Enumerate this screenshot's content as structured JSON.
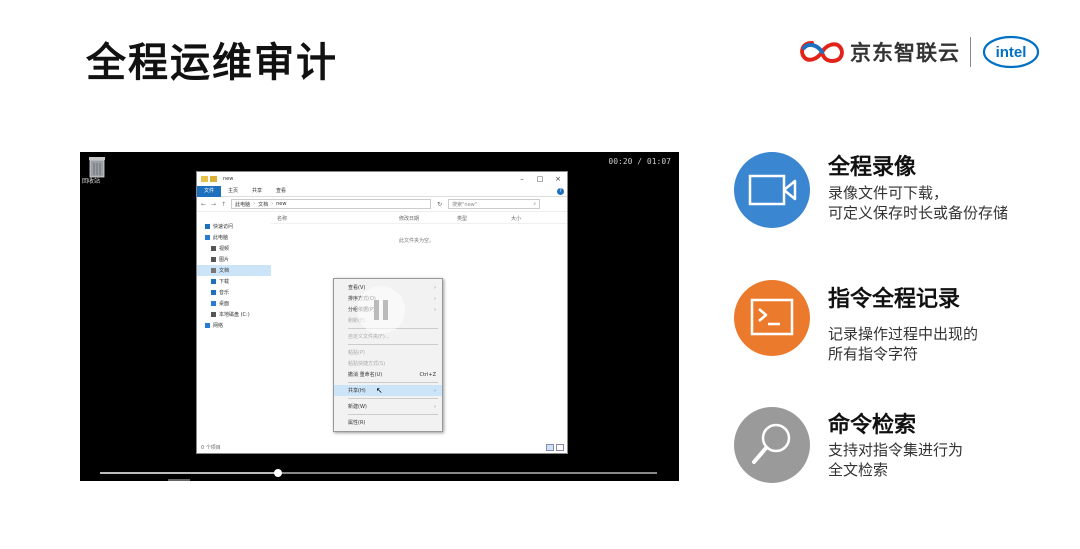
{
  "slide": {
    "title": "全程运维审计"
  },
  "brand": {
    "jd_text": "京东智联云",
    "intel_text": "intel"
  },
  "video": {
    "timecode": "00:20 / 01:07",
    "progress_fraction": 0.32,
    "desktop": {
      "trash_label": "回收站"
    },
    "explorer": {
      "title": "new",
      "ribbon_tabs": [
        "文件",
        "主页",
        "共享",
        "查看"
      ],
      "address_path": [
        "此电脑",
        "文档",
        "new"
      ],
      "search_placeholder": "搜索\"new\"",
      "columns": [
        "名称",
        "修改日期",
        "类型",
        "大小"
      ],
      "empty_message": "此文件夹为空。",
      "nav_items": [
        {
          "label": "快速访问",
          "indent": false,
          "selected": false,
          "icon": "star-icon",
          "color": "#1f6fbf"
        },
        {
          "label": "此电脑",
          "indent": false,
          "selected": false,
          "icon": "computer-icon",
          "color": "#2a7bd4"
        },
        {
          "label": "视频",
          "indent": true,
          "selected": false,
          "icon": "video-icon",
          "color": "#555555"
        },
        {
          "label": "图片",
          "indent": true,
          "selected": false,
          "icon": "picture-icon",
          "color": "#555555"
        },
        {
          "label": "文档",
          "indent": true,
          "selected": true,
          "icon": "document-icon",
          "color": "#777777"
        },
        {
          "label": "下载",
          "indent": true,
          "selected": false,
          "icon": "download-icon",
          "color": "#1f6fbf"
        },
        {
          "label": "音乐",
          "indent": true,
          "selected": false,
          "icon": "music-icon",
          "color": "#1f6fbf"
        },
        {
          "label": "桌面",
          "indent": true,
          "selected": false,
          "icon": "desktop-icon",
          "color": "#2a7bd4"
        },
        {
          "label": "本地磁盘 (C:)",
          "indent": true,
          "selected": false,
          "icon": "disk-icon",
          "color": "#555555"
        },
        {
          "label": "网络",
          "indent": false,
          "selected": false,
          "icon": "network-icon",
          "color": "#2a7bd4"
        }
      ],
      "status": "0 个项目"
    },
    "context_menu": [
      {
        "label": "查看(V)",
        "arrow": true,
        "disabled": false,
        "highlight": false
      },
      {
        "label": "排序方式(O)",
        "arrow": true,
        "disabled": false,
        "highlight": false
      },
      {
        "label": "分组依据(P)",
        "arrow": true,
        "disabled": false,
        "highlight": false
      },
      {
        "label": "刷新(E)",
        "arrow": false,
        "disabled": true,
        "highlight": false
      },
      {
        "sep": true
      },
      {
        "label": "自定义文件夹(F)...",
        "arrow": false,
        "disabled": true,
        "highlight": false
      },
      {
        "sep": true
      },
      {
        "label": "粘贴(P)",
        "arrow": false,
        "disabled": true,
        "highlight": false
      },
      {
        "label": "粘贴快捷方式(S)",
        "arrow": false,
        "disabled": true,
        "highlight": false
      },
      {
        "label": "撤消 重命名(U)",
        "shortcut": "Ctrl+Z",
        "arrow": false,
        "disabled": false,
        "highlight": false
      },
      {
        "sep": true
      },
      {
        "label": "共享(H)",
        "arrow": true,
        "disabled": false,
        "highlight": true
      },
      {
        "sep": true
      },
      {
        "label": "新建(W)",
        "arrow": true,
        "disabled": false,
        "highlight": false
      },
      {
        "sep": true
      },
      {
        "label": "属性(R)",
        "arrow": false,
        "disabled": false,
        "highlight": false
      }
    ]
  },
  "features": [
    {
      "title": "全程录像",
      "desc": [
        "录像文件可下载，",
        "可定义保存时长或备份存储"
      ],
      "icon": "video-camera-icon",
      "color": "#3a86d1"
    },
    {
      "title": "指令全程记录",
      "desc": [
        "记录操作过程中出现的",
        "所有指令字符"
      ],
      "icon": "terminal-icon",
      "color": "#ec7a2d"
    },
    {
      "title": "命令检索",
      "desc": [
        "支持对指令集进行为",
        "全文检索"
      ],
      "icon": "magnifier-icon",
      "color": "#9a9a9a"
    }
  ],
  "colors": {
    "accent_blue": "#3a86d1",
    "accent_orange": "#ec7a2d",
    "accent_gray": "#9a9a9a",
    "jd_red": "#e2231a",
    "intel_blue": "#0071c5"
  }
}
